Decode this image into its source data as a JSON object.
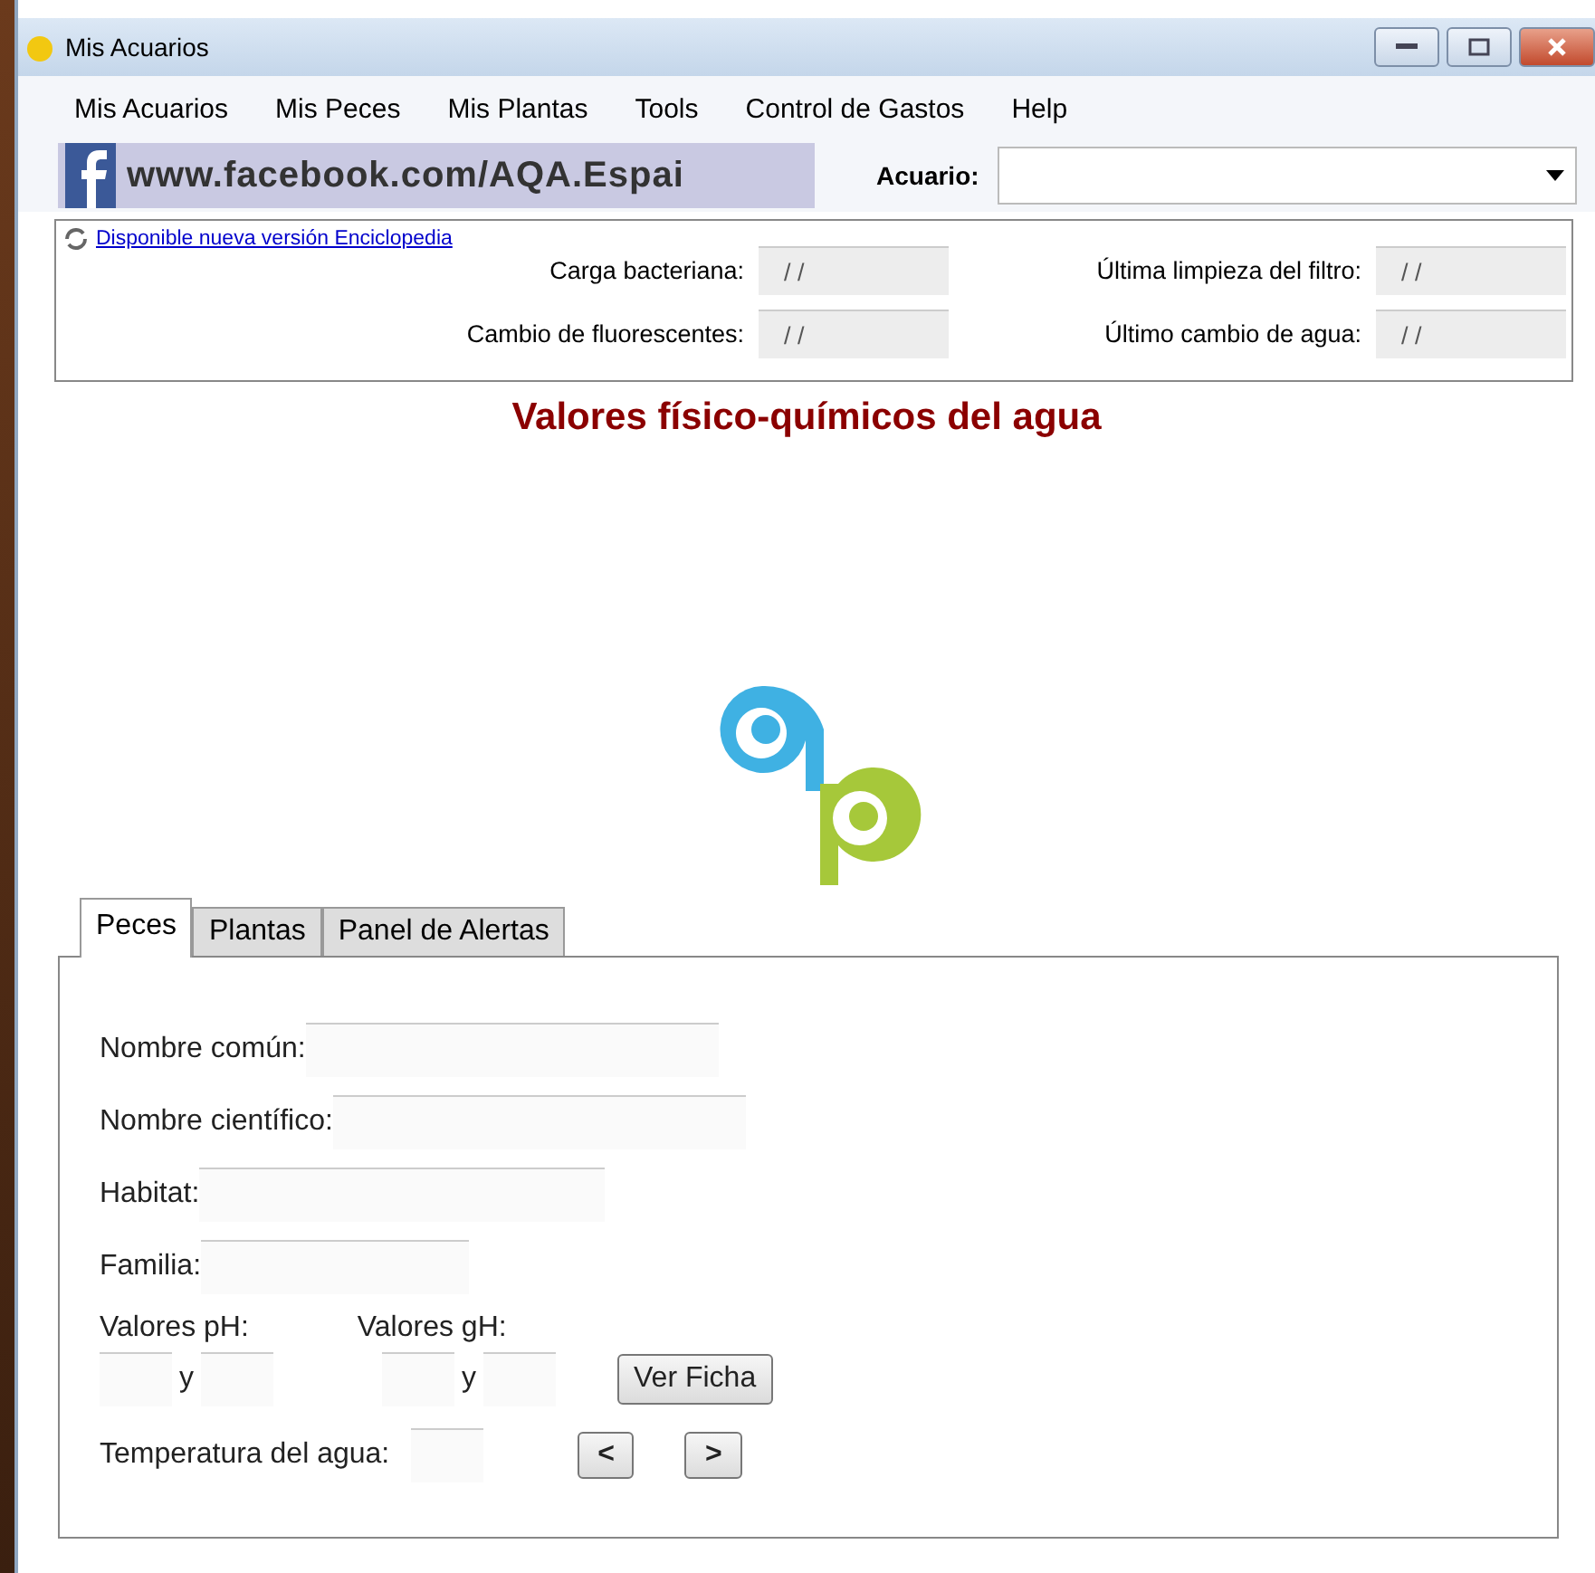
{
  "window": {
    "title": "Mis Acuarios"
  },
  "menu": [
    "Mis Acuarios",
    "Mis Peces",
    "Mis Plantas",
    "Tools",
    "Control de Gastos",
    "Help"
  ],
  "banner": {
    "text": "www.facebook.com/AQA.Espai"
  },
  "aquarium": {
    "label": "Acuario:"
  },
  "update_link": "Disponible nueva versión Enciclopedia",
  "dates": [
    {
      "label": "Carga bacteriana:",
      "value": "/ /"
    },
    {
      "label": "Última limpieza del filtro:",
      "value": "/ /"
    },
    {
      "label": "Cambio de fluorescentes:",
      "value": "/ /"
    },
    {
      "label": "Último cambio de agua:",
      "value": "/ /"
    }
  ],
  "heading": "Valores físico-químicos del agua",
  "tabs": [
    {
      "label": "Peces",
      "selected": true
    },
    {
      "label": "Plantas",
      "selected": false
    },
    {
      "label": "Panel de Alertas",
      "selected": false
    }
  ],
  "form": {
    "fields": [
      {
        "label": "Nombre común:"
      },
      {
        "label": "Nombre científico:"
      },
      {
        "label": "Habitat:"
      },
      {
        "label": "Familia:"
      }
    ],
    "ph_label": "Valores pH:",
    "gh_label": "Valores gH:",
    "ph_sep": "y",
    "gh_sep": "y",
    "details_button": "Ver Ficha",
    "temp_label": "Temperatura del agua:",
    "prev_button": "<",
    "next_button": ">"
  }
}
